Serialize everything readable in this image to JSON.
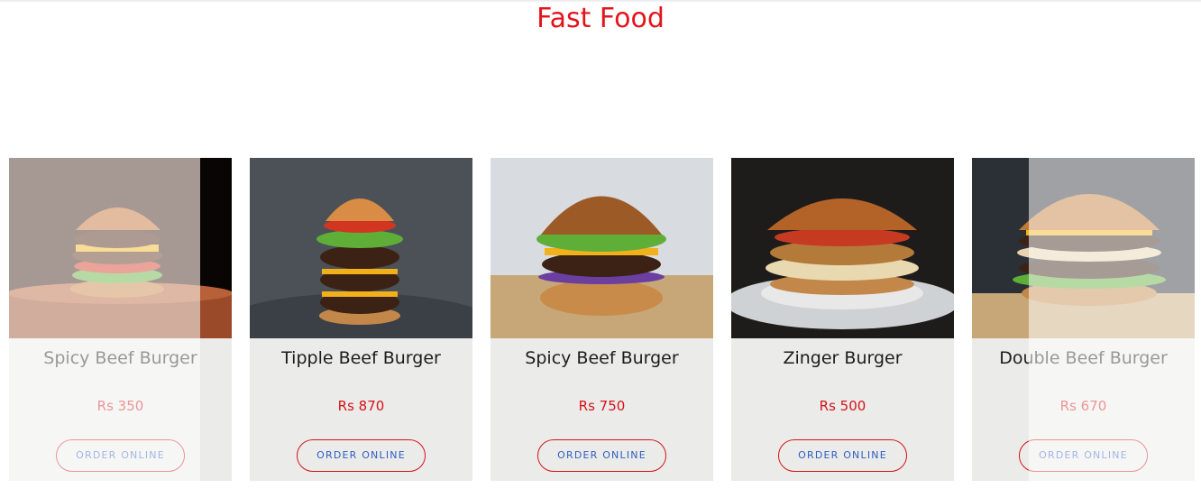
{
  "section": {
    "title": "Fast Food"
  },
  "products": [
    {
      "name": "Spicy Beef Burger",
      "price": "Rs 350",
      "button": "ORDER ONLINE",
      "image_icon": "burger-wood-board"
    },
    {
      "name": "Tipple Beef Burger",
      "price": "Rs 870",
      "button": "ORDER ONLINE",
      "image_icon": "burger-triple-stack"
    },
    {
      "name": "Spicy Beef Burger",
      "price": "Rs 750",
      "button": "ORDER ONLINE",
      "image_icon": "burger-sesame"
    },
    {
      "name": "Zinger Burger",
      "price": "Rs 500",
      "button": "ORDER ONLINE",
      "image_icon": "burger-plate"
    },
    {
      "name": "Double Beef Burger",
      "price": "Rs 670",
      "button": "ORDER ONLINE",
      "image_icon": "burger-double"
    }
  ],
  "colors": {
    "accent": "#e4141c",
    "button_text": "#2f5ec4",
    "card_bg": "#ebebe9"
  }
}
